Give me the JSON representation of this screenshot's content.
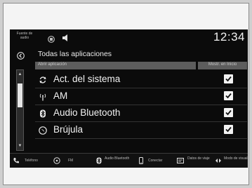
{
  "status": {
    "source_label": "Fuente de audio",
    "clock": "12:34"
  },
  "header": {
    "title": "Todas las aplicaciones"
  },
  "columns": {
    "left": "Abrir aplicación",
    "right": "Mostr. en Inicio"
  },
  "apps": [
    {
      "label": "Act. del sistema",
      "icon": "refresh-icon",
      "checked": true
    },
    {
      "label": "AM",
      "icon": "radio-antenna-icon",
      "checked": true
    },
    {
      "label": "Audio Bluetooth",
      "icon": "bluetooth-icon",
      "checked": true
    },
    {
      "label": "Brújula",
      "icon": "compass-icon",
      "checked": true
    }
  ],
  "bottombar": {
    "phone": "Teléfono",
    "fm": "FM",
    "bt_audio": "Audio Bluetooth",
    "connect": "Conectar",
    "trip": "Datos de viaje",
    "mode": "Modo de visual."
  },
  "colors": {
    "screen_bg": "#0b0b0b",
    "header_bar": "#5d5d5d",
    "text": "#f2f2f2"
  }
}
